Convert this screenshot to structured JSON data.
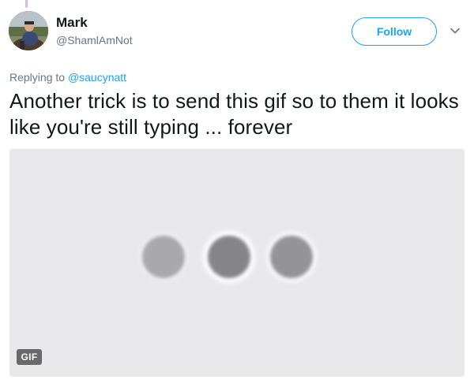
{
  "tweet": {
    "author": {
      "display_name": "Mark",
      "handle": "@ShamlAmNot",
      "avatar_icon": "profile-photo"
    },
    "follow_label": "Follow",
    "menu_icon": "chevron-down-icon",
    "replying_prefix": "Replying to",
    "replying_to": "@saucynatt",
    "text": "Another trick is to send this gif so to them it looks like you're still typing ... forever",
    "media": {
      "type": "gif",
      "badge": "GIF",
      "content_icon": "typing-indicator-dots"
    }
  },
  "colors": {
    "accent": "#1da1f2",
    "text_primary": "#14171a",
    "text_secondary": "#657786",
    "media_background": "#ebebed"
  }
}
